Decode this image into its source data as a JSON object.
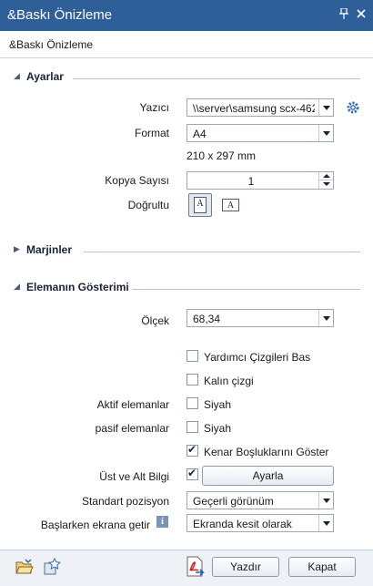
{
  "window": {
    "title": "&Baskı Önizleme",
    "pin_icon": "pin-icon",
    "close_icon": "close-icon"
  },
  "breadcrumb": "&Baskı Önizleme",
  "sections": {
    "ayarlar": "Ayarlar",
    "marjinler": "Marjinler",
    "eleman": "Elemanın Gösterimi"
  },
  "settings": {
    "printer_label": "Yazıcı",
    "printer_value": "\\\\server\\samsung scx-462",
    "format_label": "Format",
    "format_value": "A4",
    "format_size": "210 x 297 mm",
    "copies_label": "Kopya Sayısı",
    "copies_value": "1",
    "orientation_label": "Doğrultu",
    "orientation_portrait_glyph": "A",
    "orientation_landscape_glyph": "A"
  },
  "display": {
    "scale_label": "Ölçek",
    "scale_value": "68,34",
    "helper_lines": "Yardımcı Çizgileri Bas",
    "helper_lines_checked": false,
    "thick_line": "Kalın çizgi",
    "thick_line_checked": false,
    "active_label": "Aktif elemanlar",
    "active_value": "Siyah",
    "active_checked": false,
    "passive_label": "pasif elemanlar",
    "passive_value": "Siyah",
    "passive_checked": false,
    "margins": "Kenar Boşluklarını Göster",
    "margins_checked": true,
    "header_footer_label": "Üst ve Alt Bilgi",
    "header_footer_checked": true,
    "header_footer_button": "Ayarla",
    "position_label": "Standart pozisyon",
    "position_value": "Geçerli görünüm",
    "startup_label": "Başlarken ekrana getir",
    "startup_info_glyph": "i",
    "startup_value": "Ekranda kesit olarak"
  },
  "footer": {
    "print_button": "Yazdır",
    "close_button": "Kapat"
  },
  "colors": {
    "titlebar": "#2f5f98",
    "panel": "#ffffff",
    "background": "#eef1f6"
  }
}
